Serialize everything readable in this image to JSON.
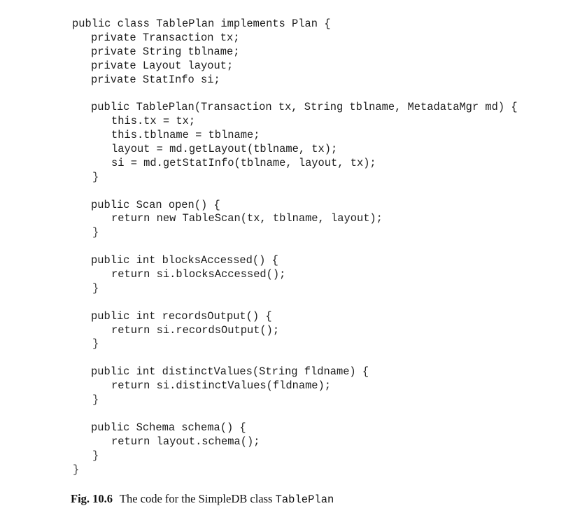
{
  "code": {
    "lines": [
      {
        "indent": "i0",
        "text": "public class TablePlan implements Plan {"
      },
      {
        "indent": "i1",
        "text": "private Transaction tx;"
      },
      {
        "indent": "i1",
        "text": "private String tblname;"
      },
      {
        "indent": "i1",
        "text": "private Layout layout;"
      },
      {
        "indent": "i1",
        "text": "private StatInfo si;"
      },
      {
        "indent": "i1",
        "text": ""
      },
      {
        "indent": "i1",
        "text": "public TablePlan(Transaction tx, String tblname, MetadataMgr md) {"
      },
      {
        "indent": "i2",
        "text": "this.tx = tx;"
      },
      {
        "indent": "i2",
        "text": "this.tblname = tblname;"
      },
      {
        "indent": "i2",
        "text": "layout = md.getLayout(tblname, tx);"
      },
      {
        "indent": "i2",
        "text": "si = md.getStatInfo(tblname, layout, tx);"
      },
      {
        "indent": "iclose",
        "text": "}"
      },
      {
        "indent": "i1",
        "text": ""
      },
      {
        "indent": "i1",
        "text": "public Scan open() {"
      },
      {
        "indent": "i2",
        "text": "return new TableScan(tx, tblname, layout);"
      },
      {
        "indent": "iclose",
        "text": "}"
      },
      {
        "indent": "i1",
        "text": ""
      },
      {
        "indent": "i1",
        "text": "public int blocksAccessed() {"
      },
      {
        "indent": "i2",
        "text": "return si.blocksAccessed();"
      },
      {
        "indent": "iclose",
        "text": "}"
      },
      {
        "indent": "i1",
        "text": ""
      },
      {
        "indent": "i1",
        "text": "public int recordsOutput() {"
      },
      {
        "indent": "i2",
        "text": "return si.recordsOutput();"
      },
      {
        "indent": "iclose",
        "text": "}"
      },
      {
        "indent": "i1",
        "text": ""
      },
      {
        "indent": "i1",
        "text": "public int distinctValues(String fldname) {"
      },
      {
        "indent": "i2",
        "text": "return si.distinctValues(fldname);"
      },
      {
        "indent": "iclose",
        "text": "}"
      },
      {
        "indent": "i1",
        "text": ""
      },
      {
        "indent": "i1",
        "text": "public Schema schema() {"
      },
      {
        "indent": "i2",
        "text": "return layout.schema();"
      },
      {
        "indent": "iclose",
        "text": "}"
      },
      {
        "indent": "iclose0",
        "text": "}"
      }
    ]
  },
  "caption": {
    "label": "Fig. 10.6",
    "text": "The code for the SimpleDB class",
    "class_name": "TablePlan"
  }
}
